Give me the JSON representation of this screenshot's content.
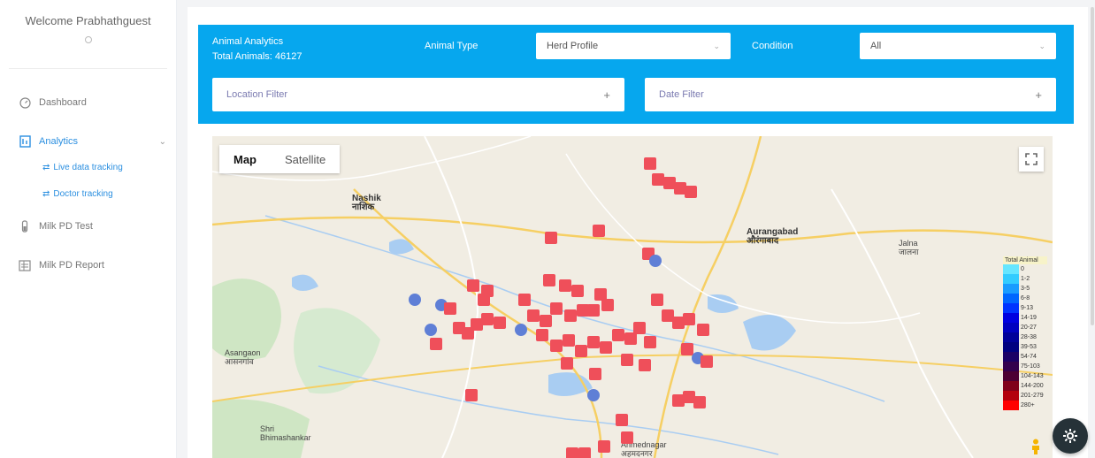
{
  "sidebar": {
    "welcome": "Welcome Prabhathguest",
    "items": [
      {
        "label": "Dashboard"
      },
      {
        "label": "Analytics"
      },
      {
        "label": "Milk PD Test"
      },
      {
        "label": "Milk PD Report"
      }
    ],
    "sub_items": [
      {
        "label": "Live data tracking"
      },
      {
        "label": "Doctor tracking"
      }
    ]
  },
  "header": {
    "title": "Animal Analytics",
    "total": "Total Animals: 46127",
    "animal_type_label": "Animal Type",
    "animal_type_value": "Herd Profile",
    "condition_label": "Condition",
    "condition_value": "All",
    "location_filter": "Location Filter",
    "date_filter": "Date Filter"
  },
  "map": {
    "tab_map": "Map",
    "tab_satellite": "Satellite",
    "cities": [
      {
        "name": "Nashik",
        "sub": "नाशिक",
        "big": true
      },
      {
        "name": "Aurangabad",
        "sub": "औरंगाबाद",
        "big": true
      },
      {
        "name": "Jalna",
        "sub": "जालना",
        "big": false
      },
      {
        "name": "Asangaon",
        "sub": "आसनगांव",
        "big": false
      },
      {
        "name": "Shri",
        "sub": "Bhimashankar",
        "big": false
      },
      {
        "name": "Ahmednagar",
        "sub": "अहमदनगर",
        "big": false
      }
    ],
    "legend_title": "Total Animal",
    "legend_values": [
      "0",
      "1-2",
      "3-5",
      "6-8",
      "9-13",
      "14-19",
      "20-27",
      "28-38",
      "39-53",
      "54-74",
      "75-103",
      "104-143",
      "144-200",
      "201-279",
      "280+"
    ],
    "legend_colors": [
      "#66e6ff",
      "#33ccff",
      "#1a9cff",
      "#0066ff",
      "#0033ff",
      "#0000e0",
      "#0000c0",
      "#00009a",
      "#000080",
      "#1a0066",
      "#33004d",
      "#4d0033",
      "#80001a",
      "#b3000d",
      "#ff0000"
    ]
  }
}
